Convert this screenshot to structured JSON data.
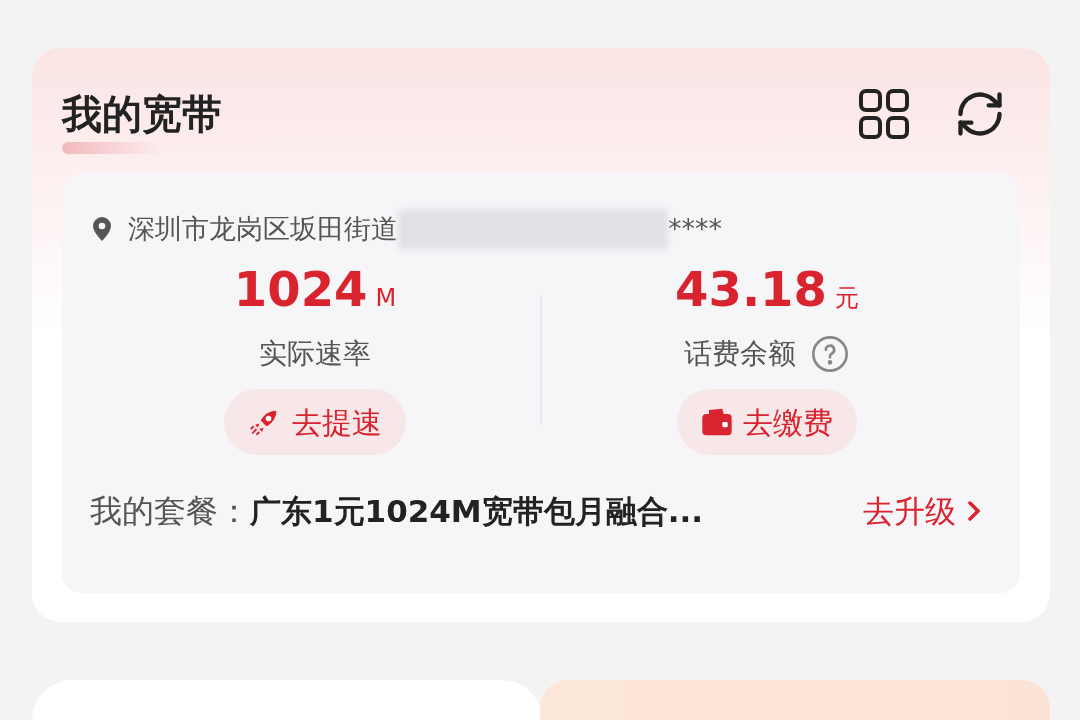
{
  "card": {
    "title": "我的宽带"
  },
  "address": {
    "visible": "深圳市龙岗区坂田街道",
    "masked": "****"
  },
  "stats": [
    {
      "kind": "speed",
      "value": "1024",
      "unit": "M",
      "label": "实际速率",
      "help": false,
      "action": "去提速"
    },
    {
      "kind": "balance",
      "value": "43.18",
      "unit": "元",
      "label": "话费余额",
      "help": true,
      "action": "去缴费"
    }
  ],
  "plan": {
    "label": "我的套餐：",
    "name": "广东1元1024M宽带包月融合...",
    "link": "去升级"
  }
}
